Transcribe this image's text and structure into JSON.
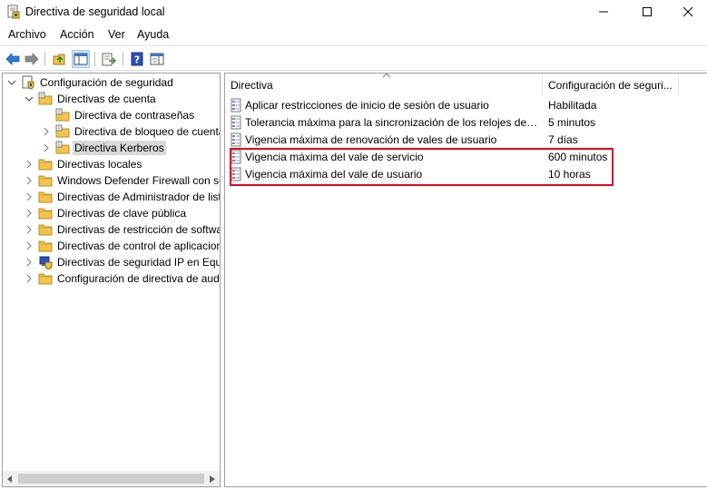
{
  "window": {
    "title": "Directiva de seguridad local"
  },
  "menu": {
    "items": [
      "Archivo",
      "Acción",
      "Ver",
      "Ayuda"
    ]
  },
  "tree": {
    "items": [
      {
        "label": "Configuración de seguridad",
        "level": 0,
        "expanded": true
      },
      {
        "label": "Directivas de cuenta",
        "level": 1,
        "expanded": true
      },
      {
        "label": "Directiva de contraseñas",
        "level": 2
      },
      {
        "label": "Directiva de bloqueo de cuenta",
        "level": 2
      },
      {
        "label": "Directiva Kerberos",
        "level": 2,
        "selected": true
      },
      {
        "label": "Directivas locales",
        "level": 1
      },
      {
        "label": "Windows Defender Firewall con segur",
        "level": 1
      },
      {
        "label": "Directivas de Administrador de listas d",
        "level": 1
      },
      {
        "label": "Directivas de clave pública",
        "level": 1
      },
      {
        "label": "Directivas de restricción de software",
        "level": 1
      },
      {
        "label": "Directivas de control de aplicaciones",
        "level": 1
      },
      {
        "label": "Directivas de seguridad IP en Equipo l",
        "level": 1
      },
      {
        "label": "Configuración de directiva de auditor",
        "level": 1
      }
    ]
  },
  "list": {
    "columns": [
      "Directiva",
      "Configuración de seguri..."
    ],
    "rows": [
      {
        "policy": "Aplicar restricciones de inicio de sesión de usuario",
        "setting": "Habilitada"
      },
      {
        "policy": "Tolerancia máxima para la sincronización de los relojes de lo...",
        "setting": "5 minutos"
      },
      {
        "policy": "Vigencia máxima de renovación de vales de usuario",
        "setting": "7 días"
      },
      {
        "policy": "Vigencia máxima del vale de servicio",
        "setting": "600 minutos"
      },
      {
        "policy": "Vigencia máxima del vale de usuario",
        "setting": "10 horas"
      }
    ]
  },
  "colors": {
    "highlight_border": "#e0001b",
    "selection": "#d9d9d9",
    "folder": "#f2c44d"
  }
}
